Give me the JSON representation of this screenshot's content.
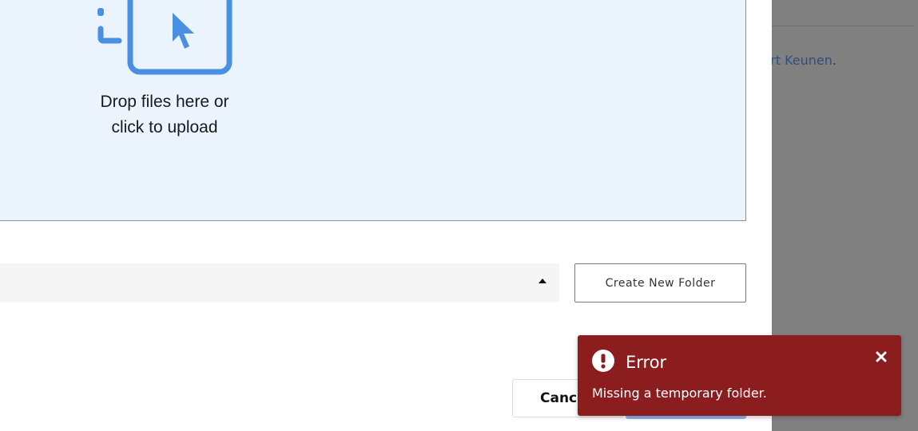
{
  "background_page": {
    "link_text": "urt Keunen",
    "link_suffix": "."
  },
  "upload_dialog": {
    "dropzone": {
      "line1": "Drop files here or",
      "line2": "click to upload",
      "icon": "upload-cursor-icon"
    },
    "toolbar": {
      "sort_icon": "caret-up-icon",
      "create_folder_label": "Create New Folder"
    },
    "footer": {
      "cancel_label": "Cancel"
    }
  },
  "toast": {
    "title": "Error",
    "message": "Missing a temporary folder.",
    "icon": "exclamation-circle-icon",
    "close_icon": "close-icon"
  },
  "colors": {
    "overlay": "#808080",
    "dropzone_bg": "#ebf4fc",
    "accent_blue": "#4a90e2",
    "toast_bg": "#8b1d1f",
    "primary_button": "#8fb4ea"
  }
}
